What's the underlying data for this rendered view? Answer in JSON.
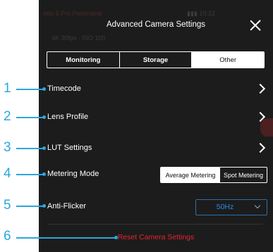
{
  "header": {
    "title": "Advanced Camera Settings"
  },
  "tabs": [
    {
      "label": "Monitoring",
      "active": false
    },
    {
      "label": "Storage",
      "active": false
    },
    {
      "label": "Other",
      "active": true
    }
  ],
  "rows": [
    {
      "label": "Timecode"
    },
    {
      "label": "Lens Profile"
    },
    {
      "label": "LUT Settings"
    },
    {
      "label": "Metering Mode"
    },
    {
      "label": "Anti-Flicker"
    }
  ],
  "metering": {
    "options": [
      "Average Metering",
      "Spot Metering"
    ],
    "selected": "Average Metering"
  },
  "anti_flicker": {
    "value": "50Hz"
  },
  "reset": {
    "label": "Reset Camera Settings"
  },
  "callouts": [
    "1",
    "2",
    "3",
    "4",
    "5",
    "6"
  ],
  "colors": {
    "panel_bg": "#1c1c1c",
    "callout": "#2aa7e0",
    "reset": "#e8242c",
    "select_value": "#2d8ae6"
  }
}
